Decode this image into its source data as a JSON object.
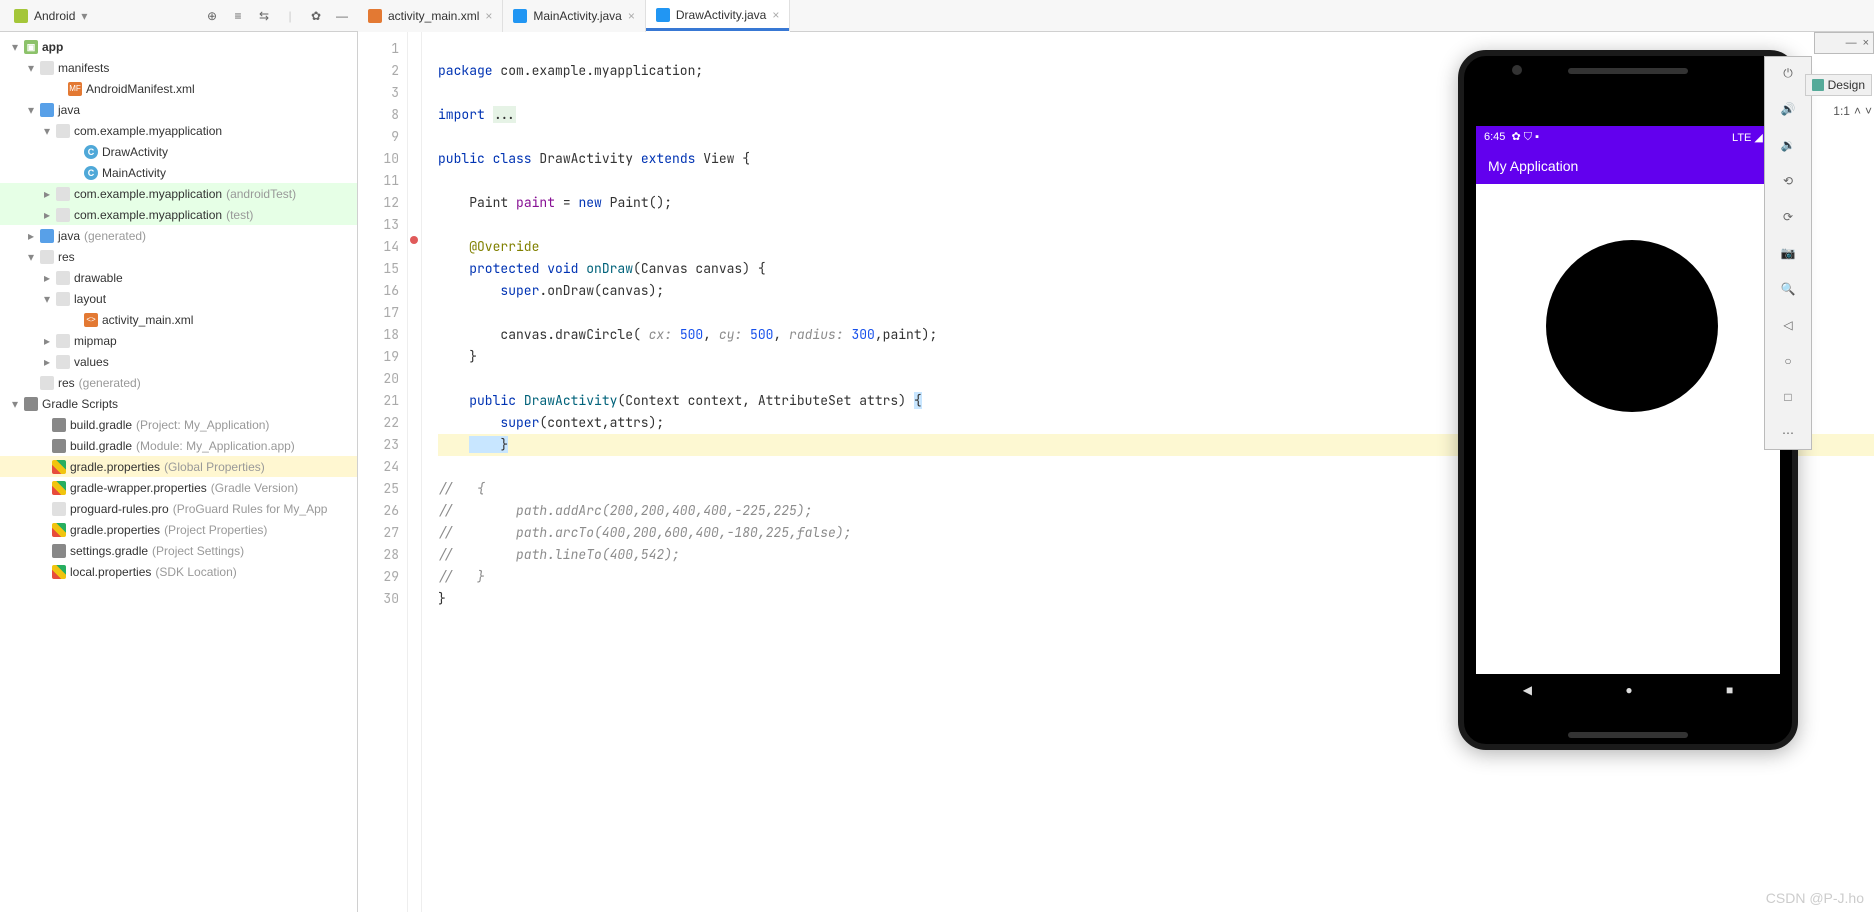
{
  "toolbar": {
    "view_selector": "Android",
    "icons": [
      "target",
      "collapse",
      "expand",
      "divider",
      "settings",
      "hide"
    ]
  },
  "tabs": [
    {
      "icon": "xml",
      "label": "activity_main.xml",
      "active": false
    },
    {
      "icon": "java",
      "label": "MainActivity.java",
      "active": false
    },
    {
      "icon": "java",
      "label": "DrawActivity.java",
      "active": true
    }
  ],
  "tree": {
    "app": "app",
    "manifests": "manifests",
    "androidManifest": "AndroidManifest.xml",
    "java": "java",
    "pkg": "com.example.myapplication",
    "drawActivity": "DrawActivity",
    "mainActivity": "MainActivity",
    "pkgAT": "com.example.myapplication",
    "pkgAT_hint": "(androidTest)",
    "pkgT": "com.example.myapplication",
    "pkgT_hint": "(test)",
    "javaGen": "java",
    "javaGen_hint": "(generated)",
    "res": "res",
    "drawable": "drawable",
    "layout": "layout",
    "activityMainXml": "activity_main.xml",
    "mipmap": "mipmap",
    "values": "values",
    "resGen": "res",
    "resGen_hint": "(generated)",
    "gradleScripts": "Gradle Scripts",
    "bgProj": "build.gradle",
    "bgProj_hint": "(Project: My_Application)",
    "bgMod": "build.gradle",
    "bgMod_hint": "(Module: My_Application.app)",
    "gp": "gradle.properties",
    "gp_hint": "(Global Properties)",
    "gwp": "gradle-wrapper.properties",
    "gwp_hint": "(Gradle Version)",
    "pro": "proguard-rules.pro",
    "pro_hint": "(ProGuard Rules for My_App",
    "gpp": "gradle.properties",
    "gpp_hint": "(Project Properties)",
    "sg": "settings.gradle",
    "sg_hint": "(Project Settings)",
    "lp": "local.properties",
    "lp_hint": "(SDK Location)"
  },
  "editor": {
    "lines": [
      "1",
      "2",
      "3",
      "8",
      "9",
      "10",
      "11",
      "12",
      "13",
      "14",
      "15",
      "16",
      "17",
      "18",
      "19",
      "20",
      "21",
      "22",
      "23",
      "24",
      "25",
      "26",
      "27",
      "28",
      "29",
      "30"
    ],
    "code": {
      "pkg": "package",
      "pkgname": " com.example.myapplication;",
      "imp": "import ",
      "impdots": "...",
      "pub": "public ",
      "cls": "class ",
      "name": "DrawActivity ",
      "ext": "extends ",
      "view": "View {",
      "paintDecl_a": "    Paint ",
      "paintDecl_b": "paint",
      "paintDecl_c": " = ",
      "newkw": "new ",
      "paintDecl_d": "Paint();",
      "ov": "    @Override",
      "prot": "    protected ",
      "void": "void ",
      "ondraw": "onDraw",
      "ondrawArgs": "(Canvas canvas) {",
      "superOn": "        super",
      "superOn2": ".onDraw(canvas);",
      "drawc": "        canvas.drawCircle( ",
      "cx": "cx: ",
      "cxv": "500",
      ", ": "",
      "cy": "cy: ",
      "cyv": "500",
      ", 2": "",
      "rad": "radius: ",
      "radv": "300",
      "drawc2": ",paint);",
      "close1": "    }",
      "ctor1": "    public ",
      "ctorName": "DrawActivity",
      "ctorArgs": "(Context context, AttributeSet attrs) ",
      "ctorBrace": "{",
      "superCtor": "        super",
      "superCtor2": "(context,attrs);",
      "close2": "    }",
      "cm1": "//   {",
      "cm2": "//        path.addArc(200,200,400,400,-225,225);",
      "cm3": "//        path.arcTo(400,200,600,400,-180,225,false);",
      "cm4": "//        path.lineTo(400,542);",
      "cm5": "//   }",
      "closeClass": "}"
    }
  },
  "emulator": {
    "time": "6:45",
    "netLabel": "LTE",
    "appTitle": "My Application"
  },
  "emuToolbar": [
    "power",
    "vol-up",
    "vol-down",
    "rotate-left",
    "rotate-right",
    "camera",
    "zoom",
    "back",
    "home",
    "square",
    "more"
  ],
  "designButton": "Design",
  "zoom": "1:1",
  "watermark": "CSDN @P-J.ho"
}
